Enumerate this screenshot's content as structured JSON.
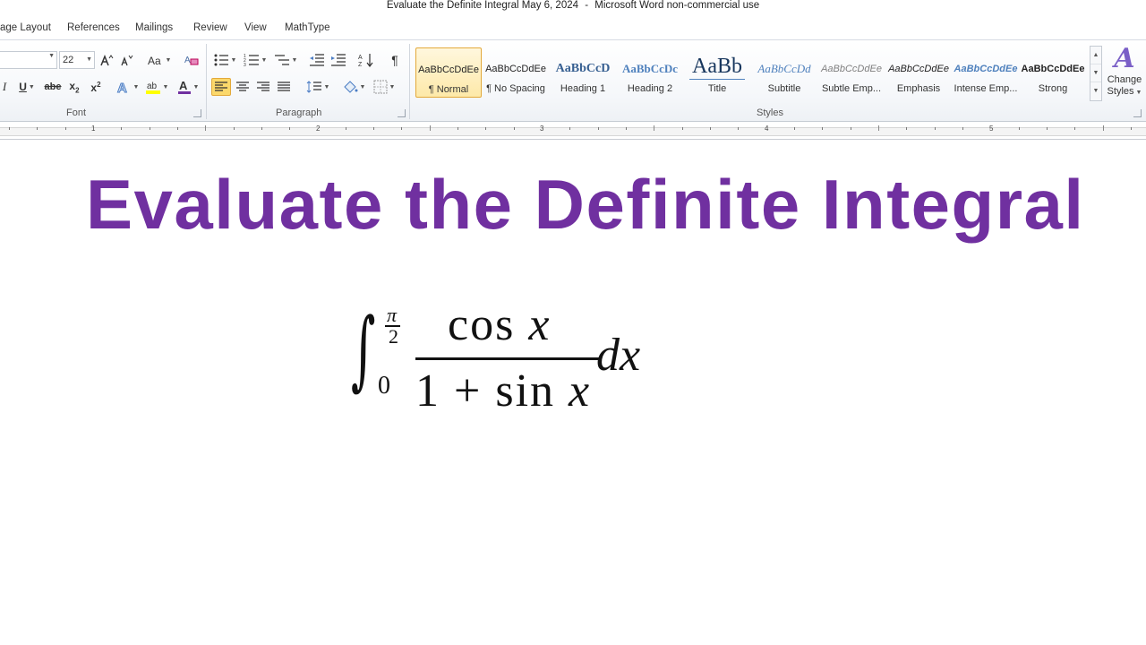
{
  "window": {
    "title": "Evaluate the Definite Integral May 6, 2024",
    "app": "Microsoft Word non-commercial use",
    "separator": "-"
  },
  "menu_tabs": [
    "age Layout",
    "References",
    "Mailings",
    "Review",
    "View",
    "MathType"
  ],
  "ribbon": {
    "font_group": {
      "label": "Font",
      "font_size": "22"
    },
    "paragraph_group": {
      "label": "Paragraph"
    },
    "styles_group": {
      "label": "Styles",
      "items": [
        {
          "sample": "AaBbCcDdEe",
          "name": "¶ Normal"
        },
        {
          "sample": "AaBbCcDdEe",
          "name": "¶ No Spacing"
        },
        {
          "sample": "AaBbCcD",
          "name": "Heading 1"
        },
        {
          "sample": "AaBbCcDc",
          "name": "Heading 2"
        },
        {
          "sample": "AaBb",
          "name": "Title"
        },
        {
          "sample": "AaBbCcDd",
          "name": "Subtitle"
        },
        {
          "sample": "AaBbCcDdEe",
          "name": "Subtle Emp..."
        },
        {
          "sample": "AaBbCcDdEe",
          "name": "Emphasis"
        },
        {
          "sample": "AaBbCcDdEe",
          "name": "Intense Emp..."
        },
        {
          "sample": "AaBbCcDdEe",
          "name": "Strong"
        }
      ],
      "selected_index": 0
    },
    "change_styles": {
      "line1": "Change",
      "line2": "Styles"
    }
  },
  "ruler_numbers": [
    "1",
    "2",
    "3",
    "4",
    "5"
  ],
  "document": {
    "title": "Evaluate the Definite Integral",
    "title_color": "#7030a0",
    "equation": {
      "upper_limit_num": "π",
      "upper_limit_den": "2",
      "lower_limit": "0",
      "numerator_fn": "cos",
      "numerator_var": "x",
      "denominator_const": "1",
      "denominator_op": "+",
      "denominator_fn": "sin",
      "denominator_var": "x",
      "differential": "dx"
    }
  }
}
